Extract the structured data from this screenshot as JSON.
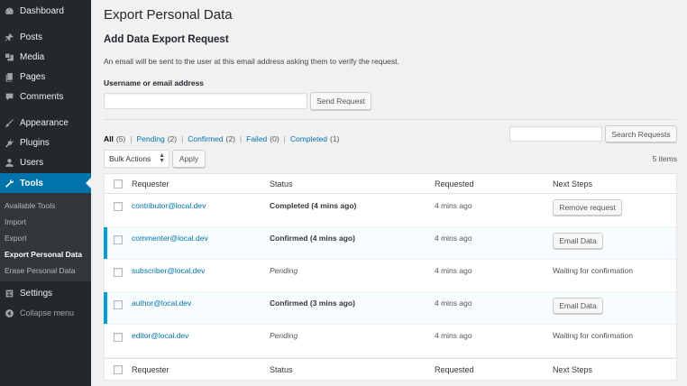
{
  "sidebar": {
    "items": [
      {
        "label": "Dashboard",
        "icon": "dashboard-icon"
      },
      {
        "label": "Posts",
        "icon": "pin-icon"
      },
      {
        "label": "Media",
        "icon": "media-icon"
      },
      {
        "label": "Pages",
        "icon": "pages-icon"
      },
      {
        "label": "Comments",
        "icon": "comment-icon"
      },
      {
        "label": "Appearance",
        "icon": "brush-icon"
      },
      {
        "label": "Plugins",
        "icon": "plug-icon"
      },
      {
        "label": "Users",
        "icon": "user-icon"
      },
      {
        "label": "Tools",
        "icon": "wrench-icon"
      },
      {
        "label": "Settings",
        "icon": "settings-icon"
      },
      {
        "label": "Collapse menu",
        "icon": "collapse-icon"
      }
    ],
    "submenu": [
      "Available Tools",
      "Import",
      "Export",
      "Export Personal Data",
      "Erase Personal Data"
    ]
  },
  "page": {
    "title": "Export Personal Data",
    "section_title": "Add Data Export Request",
    "description": "An email will be sent to the user at this email address asking them to verify the request.",
    "field_label": "Username or email address",
    "email_value": "",
    "send_button": "Send Request",
    "search_value": "",
    "search_button": "Search Requests",
    "bulk_select": "Bulk Actions",
    "apply_button": "Apply",
    "items_count": "5 items"
  },
  "filters": [
    {
      "label": "All",
      "count": "(5)"
    },
    {
      "label": "Pending",
      "count": "(2)"
    },
    {
      "label": "Confirmed",
      "count": "(2)"
    },
    {
      "label": "Failed",
      "count": "(0)"
    },
    {
      "label": "Completed",
      "count": "(1)"
    }
  ],
  "table": {
    "columns": [
      "Requester",
      "Status",
      "Requested",
      "Next Steps"
    ],
    "rows": [
      {
        "requester": "contributor@local.dev",
        "status": "Completed (4 mins ago)",
        "requested": "4 mins ago",
        "next": "Remove request"
      },
      {
        "requester": "commenter@local.dev",
        "status": "Confirmed (4 mins ago)",
        "requested": "4 mins ago",
        "next": "Email Data"
      },
      {
        "requester": "subscriber@local.dev",
        "status": "Pending",
        "requested": "4 mins ago",
        "next": "Waiting for confirmation"
      },
      {
        "requester": "author@local.dev",
        "status": "Confirmed (3 mins ago)",
        "requested": "4 mins ago",
        "next": "Email Data"
      },
      {
        "requester": "editor@local.dev",
        "status": "Pending",
        "requested": "4 mins ago",
        "next": "Waiting for confirmation"
      }
    ]
  },
  "colors": {
    "sidebar": "#23282d",
    "accent": "#0073aa",
    "highlight_bar": "#00a0d2"
  }
}
